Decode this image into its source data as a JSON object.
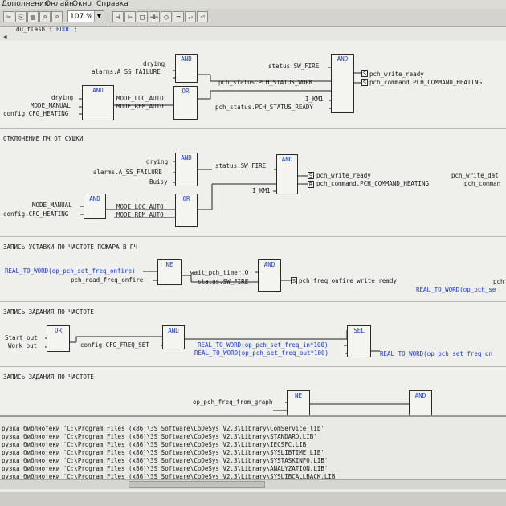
{
  "menu": [
    "Дополнения",
    "Онлайн",
    "Окно",
    "Справка"
  ],
  "toolbar": {
    "zoom": "107 %",
    "icons": [
      "cut-icon",
      "copy-icon",
      "paste-icon",
      "find-icon",
      "find-next-icon",
      "input-icon",
      "output-icon",
      "box-icon",
      "contact-icon",
      "coil-icon",
      "negate-icon",
      "jump-icon"
    ]
  },
  "declaration": {
    "variable": "du_flash",
    "type": "BOOL",
    "suffix": ";"
  },
  "network1": {
    "in_a": [
      "drying",
      "alarms.A_SS_FAILURE"
    ],
    "in_b": [
      "drying",
      "MODE_MANUAL",
      "config.CFG_HEATING"
    ],
    "and_left": "AND",
    "or_mid": "OR",
    "and_top": "AND",
    "mode_out": [
      "MODE_LOC_AUTO",
      "MODE_REM_AUTO"
    ],
    "mid_in": [
      "status.SW_FIRE",
      "pch_status.PCH_STATUS_WORK",
      "I_KM1",
      "pch_status.PCH_STATUS_READY"
    ],
    "and_right": "AND",
    "coils": [
      "S",
      "S"
    ],
    "outputs": [
      "pch_write_ready",
      "pch_command.PCH_COMMAND_HEATING"
    ]
  },
  "network2": {
    "title": "ОТКЛЮЧЕНИЕ ПЧ ОТ СУШКИ",
    "in_a": [
      "drying",
      "alarms.A_SS_FAILURE",
      "Buisy"
    ],
    "in_b": [
      "MODE_MANUAL",
      "config.CFG_HEATING"
    ],
    "and1": "AND",
    "and2": "AND",
    "or1": "OR",
    "and3": "AND",
    "mode_out": [
      "MODE_LOC_AUTO",
      "MODE_REM_AUTO"
    ],
    "mid_in": [
      "status.SW_FIRE",
      "I_KM1"
    ],
    "coils": [
      "S",
      "R"
    ],
    "outputs": [
      "pch_write_ready",
      "pch_command.PCH_COMMAND_HEATING"
    ],
    "right_cut": [
      "pch_write_dat",
      "pch_comman"
    ]
  },
  "network3": {
    "title": "ЗАПИСЬ УСТАВКИ ПО ЧАСТОТЕ ПОЖАРА В ПЧ",
    "input_fn": "REAL_TO_WORD(op_pch_set_freq_onfire)",
    "input_2": "pch_read_freq_onfire",
    "ne": "NE",
    "wait": "wait_pch_timer.Q",
    "fire": "status.SW_FIRE",
    "and": "AND",
    "coil": "S",
    "output": "pch_freq_onfire_write_ready",
    "right_fn": "REAL_TO_WORD(op_pch_se",
    "right_cut": "pch"
  },
  "network4": {
    "title": "ЗАПИСЬ ЗАДАНИЯ ПО ЧАСТОТЕ",
    "inputs": [
      "Start_out",
      "Work_out"
    ],
    "or": "OR",
    "cfg": "config.CFG_FREQ_SET",
    "and": "AND",
    "sel": "SEL",
    "expr1": "REAL_TO_WORD(op_pch_set_freq_in*100)",
    "expr2": "REAL_TO_WORD(op_pch_set_freq_out*100)",
    "right_fn": "REAL_TO_WORD(op_pch_set_freq_on"
  },
  "network5": {
    "title": "ЗАПИСЬ ЗАДАНИЯ ПО ЧАСТОТЕ",
    "input": "op_pch_freq_from_graph",
    "ne": "NE",
    "and": "AND"
  },
  "messages": [
    "рузка библиотеки 'C:\\Program Files (x86)\\3S Software\\CoDeSys V2.3\\Library\\ComService.lib'",
    "рузка библиотеки 'C:\\Program Files (x86)\\3S Software\\CoDeSys V2.3\\Library\\STANDARD.LIB'",
    "рузка библиотеки 'C:\\Program Files (x86)\\3S Software\\CoDeSys V2.3\\Library\\IECSFC.LIB'",
    "рузка библиотеки 'C:\\Program Files (x86)\\3S Software\\CoDeSys V2.3\\Library\\SYSLIBTIME.LIB'",
    "рузка библиотеки 'C:\\Program Files (x86)\\3S Software\\CoDeSys V2.3\\Library\\SYSTASKINFO.LIB'",
    "рузка библиотеки 'C:\\Program Files (x86)\\3S Software\\CoDeSys V2.3\\Library\\ANALYZATION.LIB'",
    "рузка библиотеки 'C:\\Program Files (x86)\\3S Software\\CoDeSys V2.3\\Library\\SYSLIBCALLBACK.LIB'"
  ]
}
